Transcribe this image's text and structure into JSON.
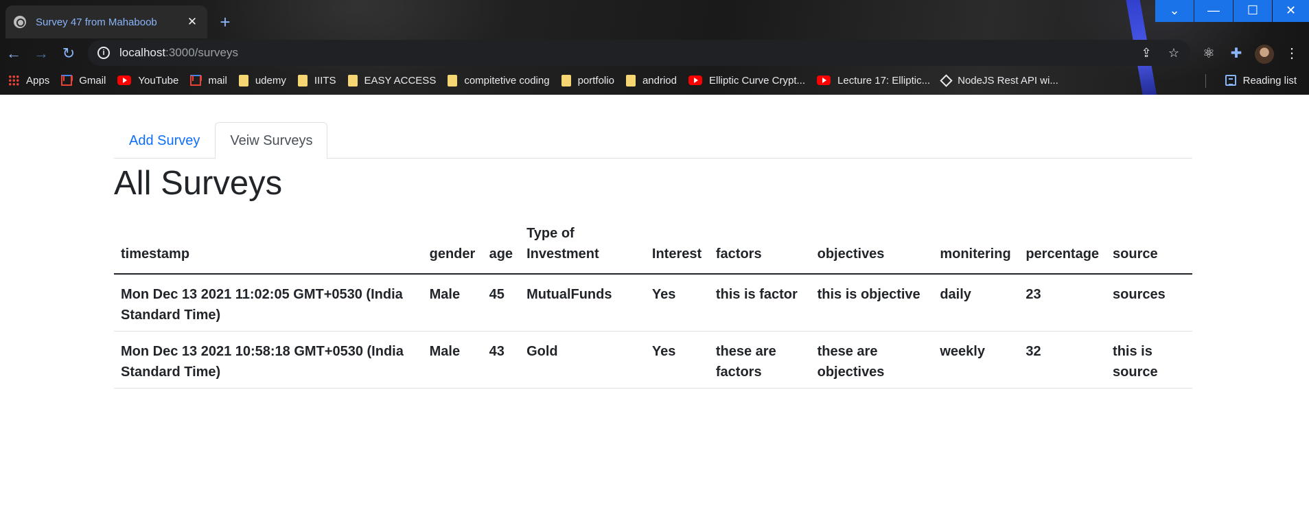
{
  "browser": {
    "tab_title": "Survey 47 from Mahaboob",
    "url_host": "localhost",
    "url_path": ":3000/surveys",
    "bookmarks": [
      {
        "label": "Apps",
        "icon": "apps-grid-icon"
      },
      {
        "label": "Gmail",
        "icon": "gmail-icon"
      },
      {
        "label": "YouTube",
        "icon": "youtube-icon"
      },
      {
        "label": "mail",
        "icon": "gmail-icon"
      },
      {
        "label": "udemy",
        "icon": "folder-icon"
      },
      {
        "label": "IIITS",
        "icon": "folder-icon"
      },
      {
        "label": "EASY ACCESS",
        "icon": "folder-icon"
      },
      {
        "label": "compitetive coding",
        "icon": "folder-icon"
      },
      {
        "label": "portfolio",
        "icon": "folder-icon"
      },
      {
        "label": "andriod",
        "icon": "folder-icon"
      },
      {
        "label": "Elliptic Curve Crypt...",
        "icon": "youtube-icon"
      },
      {
        "label": "Lecture 17: Elliptic...",
        "icon": "youtube-icon"
      },
      {
        "label": "NodeJS Rest API wi...",
        "icon": "nodejs-icon"
      }
    ],
    "reading_list": "Reading list"
  },
  "page": {
    "tabs": [
      {
        "label": "Add Survey",
        "active": false
      },
      {
        "label": "Veiw Surveys",
        "active": true
      }
    ],
    "title": "All Surveys",
    "table": {
      "headers": [
        "timestamp",
        "gender",
        "age",
        "Type of Investment",
        "Interest",
        "factors",
        "objectives",
        "monitering",
        "percentage",
        "source"
      ],
      "rows": [
        [
          "Mon Dec 13 2021 11:02:05 GMT+0530 (India Standard Time)",
          "Male",
          "45",
          "MutualFunds",
          "Yes",
          "this is factor",
          "this is objective",
          "daily",
          "23",
          "sources"
        ],
        [
          "Mon Dec 13 2021 10:58:18 GMT+0530 (India Standard Time)",
          "Male",
          "43",
          "Gold",
          "Yes",
          "these are factors",
          "these are objectives",
          "weekly",
          "32",
          "this is source"
        ]
      ]
    }
  },
  "colors": {
    "link": "#0d6efd",
    "accent_blue": "#1a73e8",
    "text": "#212529"
  }
}
